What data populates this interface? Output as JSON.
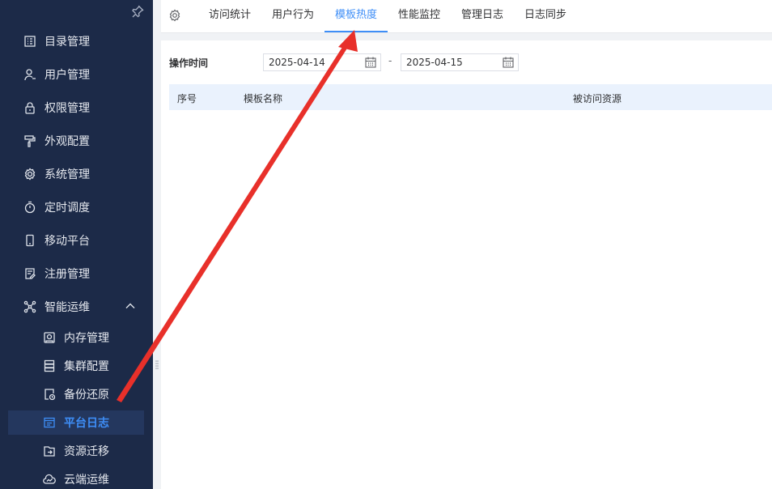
{
  "sidebar": {
    "pin_icon": "pin-icon",
    "items": [
      {
        "label": "目录管理",
        "icon": "list-icon"
      },
      {
        "label": "用户管理",
        "icon": "user-icon"
      },
      {
        "label": "权限管理",
        "icon": "lock-icon"
      },
      {
        "label": "外观配置",
        "icon": "paint-roller-icon"
      },
      {
        "label": "系统管理",
        "icon": "gear-icon"
      },
      {
        "label": "定时调度",
        "icon": "timer-icon"
      },
      {
        "label": "移动平台",
        "icon": "mobile-icon"
      },
      {
        "label": "注册管理",
        "icon": "register-icon"
      },
      {
        "label": "智能运维",
        "icon": "network-icon",
        "expanded": true
      }
    ],
    "sub_items": [
      {
        "label": "内存管理",
        "icon": "memory-icon"
      },
      {
        "label": "集群配置",
        "icon": "server-icon"
      },
      {
        "label": "备份还原",
        "icon": "backup-icon"
      },
      {
        "label": "平台日志",
        "icon": "log-icon",
        "active": true
      },
      {
        "label": "资源迁移",
        "icon": "migrate-icon"
      },
      {
        "label": "云端运维",
        "icon": "cloud-icon"
      }
    ]
  },
  "tabs": [
    {
      "label": "访问统计"
    },
    {
      "label": "用户行为"
    },
    {
      "label": "模板热度",
      "active": true
    },
    {
      "label": "性能监控"
    },
    {
      "label": "管理日志"
    },
    {
      "label": "日志同步"
    }
  ],
  "filter": {
    "label": "操作时间",
    "start_date": "2025-04-14",
    "separator": "-",
    "end_date": "2025-04-15"
  },
  "table": {
    "columns": [
      "序号",
      "模板名称",
      "被访问资源"
    ]
  },
  "colors": {
    "sidebar_bg": "#1c2a48",
    "accent": "#3e8ef7",
    "annotation_arrow": "#e8302a"
  }
}
